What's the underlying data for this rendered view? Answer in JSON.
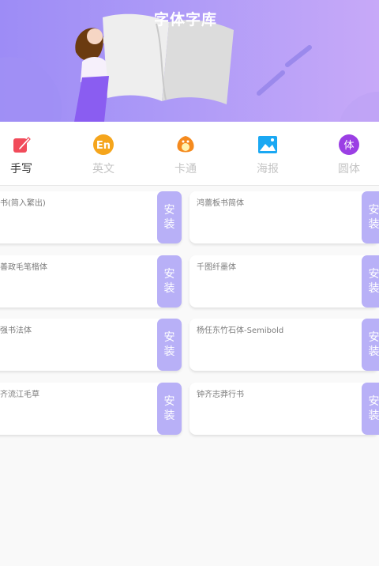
{
  "header": {
    "title": "字体字库"
  },
  "tabs": [
    {
      "label": "手写",
      "icon": "handwriting-pen-icon",
      "active": true,
      "color": "#f14b5a"
    },
    {
      "label": "英文",
      "icon": "english-en-icon",
      "active": false,
      "color": "#f5a51c"
    },
    {
      "label": "卡通",
      "icon": "cartoon-icon",
      "active": false,
      "color": "#f58a1e"
    },
    {
      "label": "海报",
      "icon": "poster-image-icon",
      "active": false,
      "color": "#1aa8f3"
    },
    {
      "label": "圆体",
      "icon": "round-font-icon",
      "active": false,
      "color": "#9b3fe4"
    }
  ],
  "tab_icon_texts": {
    "english": "En",
    "round": "体"
  },
  "fonts": [
    {
      "name": "书(简入繁出)",
      "install_label": "安装"
    },
    {
      "name": "鸿蕾板书简体",
      "install_label": "安装"
    },
    {
      "name": "善政毛笔楷体",
      "install_label": "安装"
    },
    {
      "name": "千图纤墨体",
      "install_label": "安装"
    },
    {
      "name": "强书法体",
      "install_label": "安装"
    },
    {
      "name": "杨任东竹石体-Semibold",
      "install_label": "安装"
    },
    {
      "name": "齐流江毛草",
      "install_label": "安装"
    },
    {
      "name": "钟齐志莽行书",
      "install_label": "安装"
    }
  ],
  "colors": {
    "accent": "#b8b0f7",
    "header_start": "#9d8cf6",
    "header_end": "#c7a9f8"
  }
}
